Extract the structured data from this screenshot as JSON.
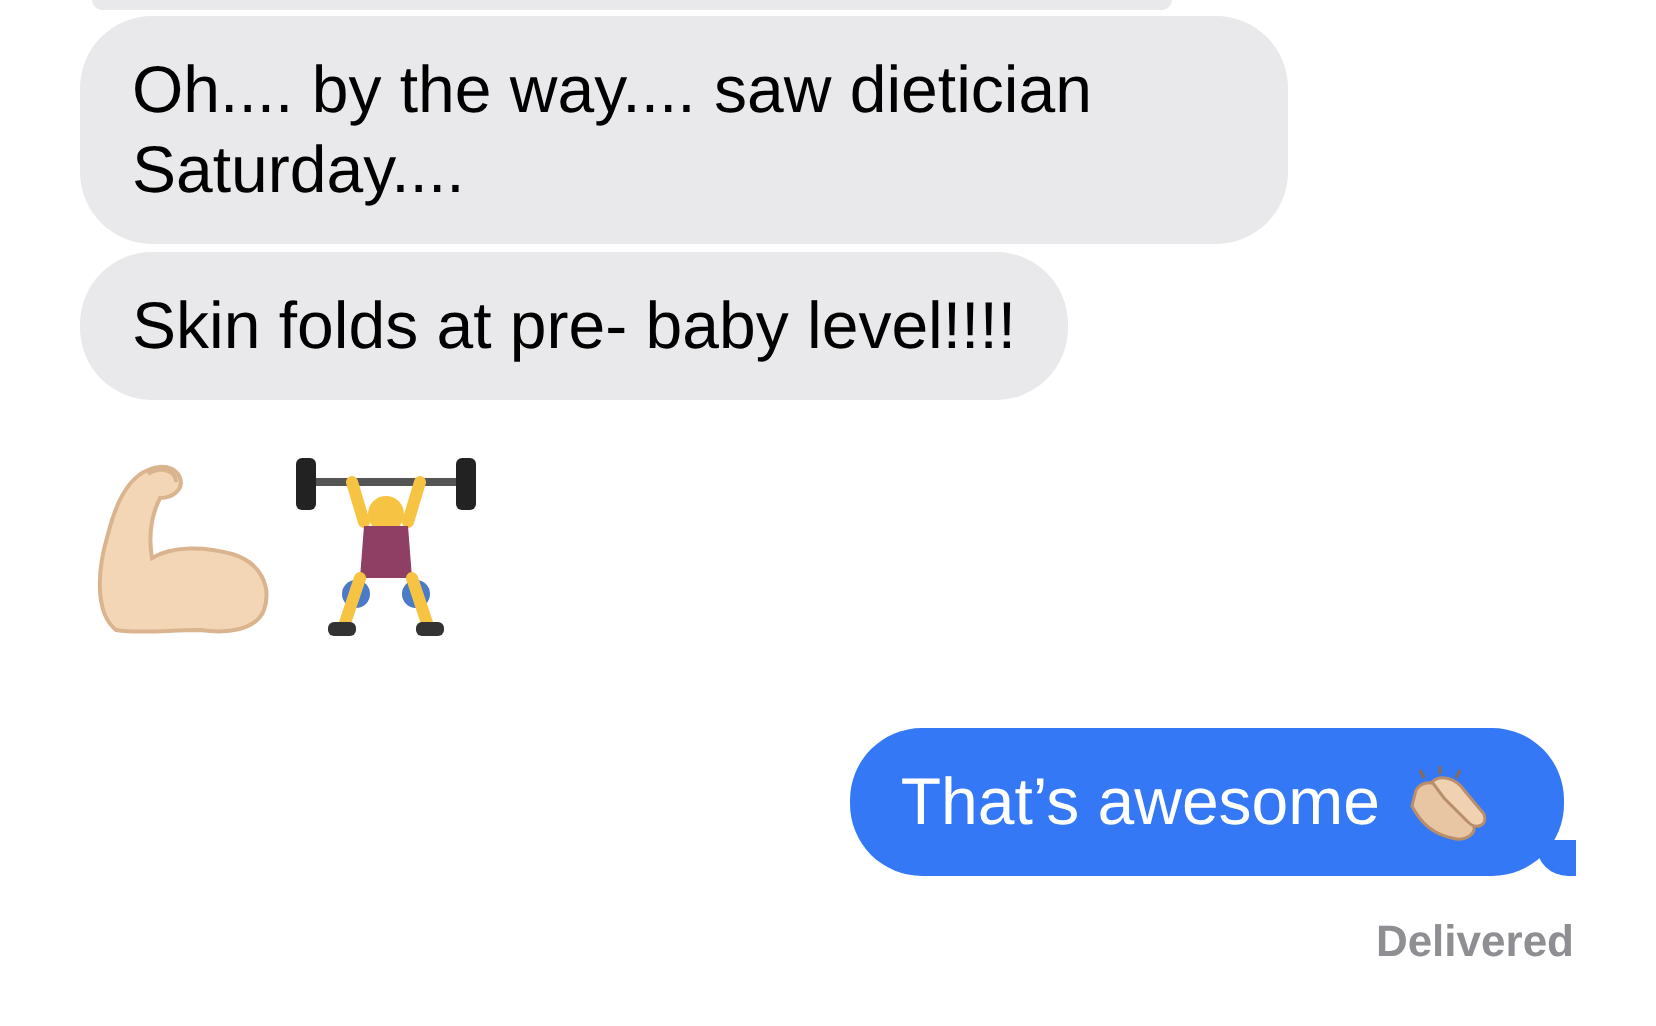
{
  "messages": [
    {
      "kind": "received",
      "text": "Oh.... by the way.... saw dietician Saturday...."
    },
    {
      "kind": "received",
      "text": "Skin folds at pre- baby level!!!!"
    },
    {
      "kind": "emoji"
    },
    {
      "kind": "sent",
      "text": "That’s awesome"
    }
  ],
  "status": "Delivered"
}
